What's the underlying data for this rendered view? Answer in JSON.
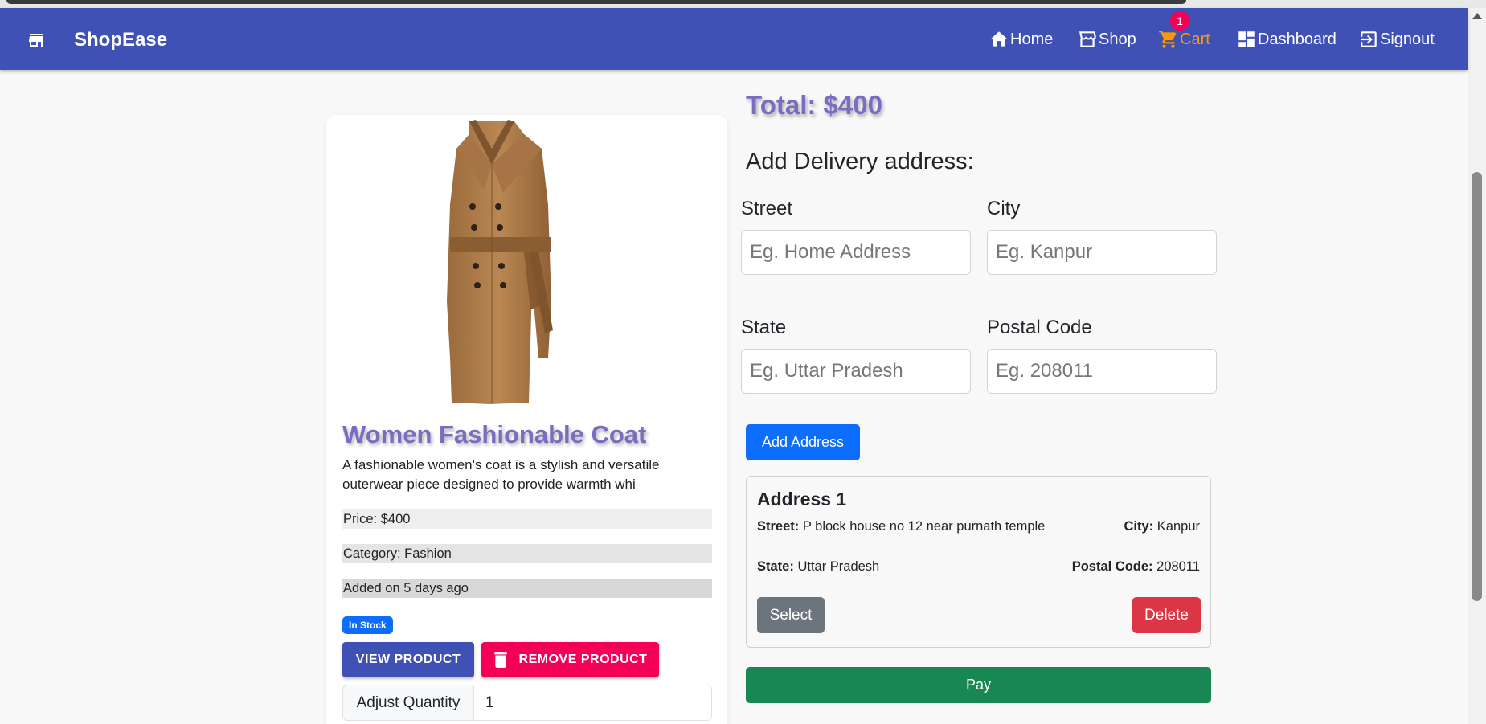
{
  "navbar": {
    "brand": "ShopEase",
    "brand_icon": "store-icon",
    "items": [
      {
        "label": "Home",
        "icon": "home-icon"
      },
      {
        "label": "Shop",
        "icon": "storefront-icon"
      },
      {
        "label": "Cart",
        "icon": "cart-icon",
        "badge": "1"
      },
      {
        "label": "Dashboard",
        "icon": "dashboard-icon"
      },
      {
        "label": "Signout",
        "icon": "signout-icon"
      }
    ],
    "colors": {
      "background": "#3f51b5",
      "cart_active": "#ff9800",
      "badge": "#f50057"
    }
  },
  "product": {
    "title": "Women Fashionable Coat",
    "description": "A fashionable women's coat is a stylish and versatile outerwear piece designed to provide warmth whi",
    "price": "Price: $400",
    "category": "Category: Fashion",
    "added": "Added on 5 days ago",
    "stock_badge": "In Stock",
    "view_label": "VIEW PRODUCT",
    "remove_label": "REMOVE PRODUCT",
    "quantity_label": "Adjust Quantity",
    "quantity_value": "1"
  },
  "checkout": {
    "total": "Total: $400",
    "address_heading": "Add Delivery address:",
    "fields": {
      "street_label": "Street",
      "street_placeholder": "Eg. Home Address",
      "city_label": "City",
      "city_placeholder": "Eg. Kanpur",
      "state_label": "State",
      "state_placeholder": "Eg. Uttar Pradesh",
      "postal_label": "Postal Code",
      "postal_placeholder": "Eg. 208011"
    },
    "add_address_label": "Add Address",
    "address_card": {
      "title": "Address 1",
      "street_key": "Street:",
      "street": "P block house no 12 near purnath temple",
      "city_key": "City:",
      "city": "Kanpur",
      "state_key": "State:",
      "state": "Uttar Pradesh",
      "postal_key": "Postal Code:",
      "postal": "208011",
      "select_label": "Select",
      "delete_label": "Delete"
    },
    "pay_label": "Pay"
  }
}
